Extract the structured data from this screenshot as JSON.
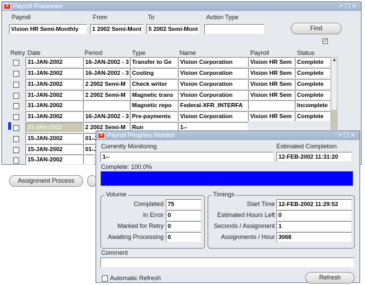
{
  "main_window": {
    "title": "Payroll Processes",
    "header_labels": {
      "payroll": "Payroll",
      "from": "From",
      "to": "To",
      "action_type": "Action Type"
    },
    "filters": {
      "payroll": "Vision HR Semi-Monthly",
      "from": "1 2002 Semi-Mont",
      "to": "5 2002 Semi-Mont",
      "action_type": ""
    },
    "find_label": "Find",
    "columns": {
      "retry": "Retry",
      "date": "Date",
      "period": "Period",
      "type": "Type",
      "name": "Name",
      "payroll": "Payroll",
      "status": "Status"
    },
    "rows": [
      {
        "date": "31-JAN-2002",
        "period": "16-JAN-2002 - 3",
        "type": "Transfer to Ge",
        "name": "Vision Corporation",
        "payroll": "Vision HR Sem",
        "status": "Complete"
      },
      {
        "date": "31-JAN-2002",
        "period": "16-JAN-2002 - 3",
        "type": "Costing",
        "name": "Vision Corporation",
        "payroll": "Vision HR Sem",
        "status": "Complete"
      },
      {
        "date": "31-JAN-2002",
        "period": "2 2002 Semi-M",
        "type": "Check writer",
        "name": "Vision Corporation",
        "payroll": "Vision HR Sem",
        "status": "Complete"
      },
      {
        "date": "31-JAN-2002",
        "period": "2 2002 Semi-M",
        "type": "Magnetic trans",
        "name": "Vision Corporation",
        "payroll": "Vision HR Sem",
        "status": "Complete"
      },
      {
        "date": "31-JAN-2002",
        "period": "",
        "type": "Magnetic repo",
        "name": "Federal-XFR_INTERFA",
        "payroll": "",
        "status": "Incomplete"
      },
      {
        "date": "31-JAN-2002",
        "period": "16-JAN-2002 - 3",
        "type": "Pre-payments",
        "name": "Vision Corporation",
        "payroll": "Vision HR Sem",
        "status": "Complete"
      },
      {
        "date": "31-JAN-2002",
        "period": "2 2002 Semi-M",
        "type": "Run",
        "name": "1--",
        "payroll": "",
        "status": ""
      },
      {
        "date": "15-JAN-2002",
        "period": "01-JA",
        "type": "",
        "name": "",
        "payroll": "",
        "status": ""
      },
      {
        "date": "15-JAN-2002",
        "period": "01-JA",
        "type": "",
        "name": "",
        "payroll": "",
        "status": ""
      },
      {
        "date": "15-JAN-2002",
        "period": "",
        "type": "",
        "name": "",
        "payroll": "",
        "status": ""
      }
    ],
    "assignment_process_label": "Assignment Process"
  },
  "monitor": {
    "title": "Payroll Progress Monitor",
    "currently_monitoring_label": "Currently Monitoring",
    "currently_monitoring_value": "1--",
    "estimated_completion_label": "Estimated Completion",
    "estimated_completion_value": "12-FEB-2002 11:31:20",
    "complete_label": "Complete: 100.0%",
    "progress_fraction": 1.0,
    "volume_title": "Volume",
    "volume": {
      "completed_label": "Completed",
      "completed": "75",
      "in_error_label": "In Error",
      "in_error": "0",
      "marked_label": "Marked for Retry",
      "marked": "0",
      "awaiting_label": "Awaiting Processing",
      "awaiting": "0"
    },
    "timings_title": "Timings",
    "timings": {
      "start_label": "Start Time",
      "start": "12-FEB-2002 11:29:52",
      "hours_left_label": "Estimated Hours Left",
      "hours_left": "0",
      "secs_label": "Seconds / Assignment",
      "secs": "1",
      "per_hour_label": "Assignments / Hour",
      "per_hour": "3068"
    },
    "comment_label": "Comment",
    "comment_value": "",
    "auto_refresh_label": "Automatic Refresh",
    "refresh_label": "Refresh"
  }
}
